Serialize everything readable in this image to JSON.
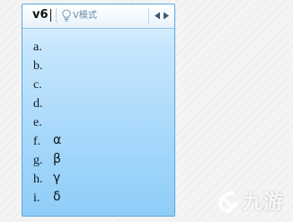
{
  "input": {
    "code": "v6"
  },
  "toolbar": {
    "mode_label": "V模式",
    "bulb_icon": "lightbulb-icon",
    "prev_icon": "triangle-left-icon",
    "next_icon": "triangle-right-icon"
  },
  "candidates": [
    {
      "key": "a.",
      "symbol": ""
    },
    {
      "key": "b.",
      "symbol": ""
    },
    {
      "key": "c.",
      "symbol": ""
    },
    {
      "key": "d.",
      "symbol": ""
    },
    {
      "key": "e.",
      "symbol": ""
    },
    {
      "key": "f.",
      "symbol": "α"
    },
    {
      "key": "g.",
      "symbol": "β"
    },
    {
      "key": "h.",
      "symbol": "γ"
    },
    {
      "key": "i.",
      "symbol": "δ"
    }
  ],
  "watermark": {
    "text": "九游"
  },
  "colors": {
    "panel_border": "#5ea9e0",
    "panel_top": "#eaf6ff",
    "panel_bottom": "#8fcdf7",
    "header_bg": "#ffffff",
    "text": "#101820",
    "mode_text": "#6e8aa0"
  }
}
